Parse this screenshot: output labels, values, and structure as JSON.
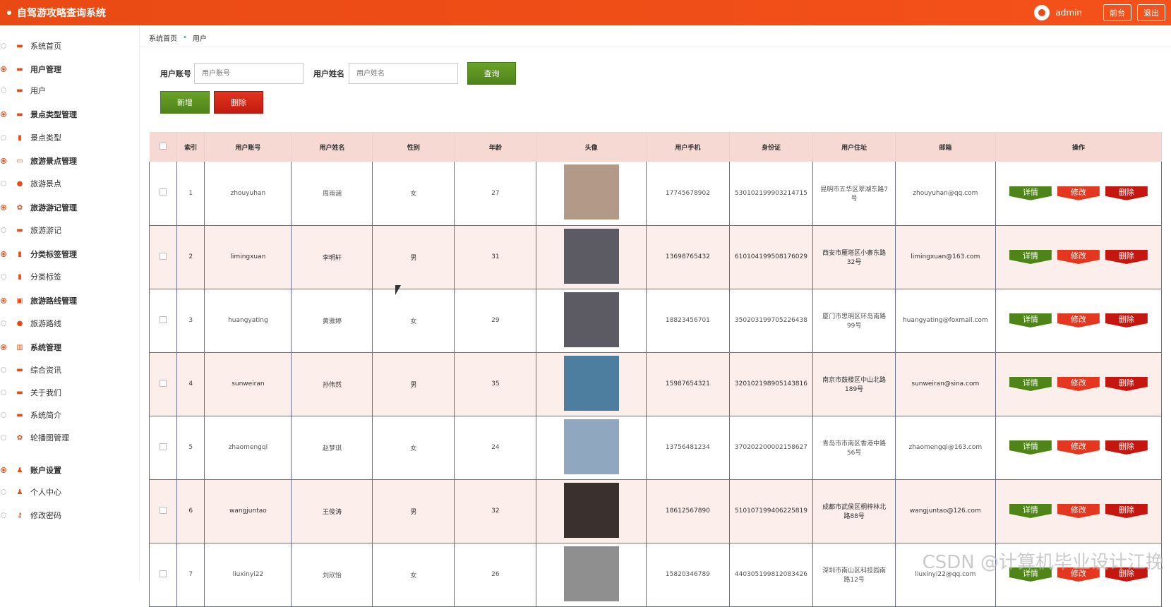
{
  "app": {
    "title": "自驾游攻略查询系统",
    "username": "admin",
    "front_btn": "前台",
    "logout_btn": "退出"
  },
  "sidebar": {
    "items": [
      {
        "label": "系统首页",
        "group": false,
        "icon": "briefcase-icon"
      },
      {
        "label": "用户管理",
        "group": true,
        "icon": "briefcase-icon"
      },
      {
        "label": "用户",
        "group": false,
        "icon": "briefcase-icon"
      },
      {
        "label": "景点类型管理",
        "group": true,
        "icon": "briefcase-icon"
      },
      {
        "label": "景点类型",
        "group": false,
        "icon": "bar-chart-icon"
      },
      {
        "label": "旅游景点管理",
        "group": true,
        "icon": "monitor-icon"
      },
      {
        "label": "旅游景点",
        "group": false,
        "icon": "location-pin-icon"
      },
      {
        "label": "旅游游记管理",
        "group": true,
        "icon": "gear-icon"
      },
      {
        "label": "旅游游记",
        "group": false,
        "icon": "briefcase-icon"
      },
      {
        "label": "分类标签管理",
        "group": true,
        "icon": "bar-chart-icon"
      },
      {
        "label": "分类标签",
        "group": false,
        "icon": "bar-chart-icon"
      },
      {
        "label": "旅游路线管理",
        "group": true,
        "icon": "image-icon"
      },
      {
        "label": "旅游路线",
        "group": false,
        "icon": "location-pin-icon"
      },
      {
        "label": "系统管理",
        "group": true,
        "icon": "building-icon"
      },
      {
        "label": "综合资讯",
        "group": false,
        "icon": "briefcase-icon"
      },
      {
        "label": "关于我们",
        "group": false,
        "icon": "briefcase-icon"
      },
      {
        "label": "系统简介",
        "group": false,
        "icon": "briefcase-icon"
      },
      {
        "label": "轮播图管理",
        "group": false,
        "icon": "gear-icon"
      },
      {
        "label": "账户设置",
        "group": true,
        "icon": "user-icon"
      },
      {
        "label": "个人中心",
        "group": false,
        "icon": "user-icon"
      },
      {
        "label": "修改密码",
        "group": false,
        "icon": "key-icon"
      }
    ]
  },
  "breadcrumb": {
    "home": "系统首页",
    "current": "用户"
  },
  "filter": {
    "account_label": "用户账号",
    "account_placeholder": "用户账号",
    "name_label": "用户姓名",
    "name_placeholder": "用户姓名",
    "query_btn": "查询",
    "add_btn": "新增",
    "delete_btn": "删除"
  },
  "table": {
    "headers": [
      "索引",
      "用户账号",
      "用户姓名",
      "性别",
      "年龄",
      "头像",
      "用户手机",
      "身份证",
      "用户住址",
      "邮箱",
      "操作"
    ],
    "rows": [
      {
        "idx": "1",
        "account": "zhouyuhan",
        "name": "周雨涵",
        "gender": "女",
        "age": "27",
        "phone": "17745678902",
        "idcard": "530102199903214715",
        "address": "昆明市五华区翠湖东路7号",
        "email": "zhouyuhan@qq.com",
        "photo_color": "#b39a88"
      },
      {
        "idx": "2",
        "account": "limingxuan",
        "name": "李明轩",
        "gender": "男",
        "age": "31",
        "phone": "13698765432",
        "idcard": "610104199508176029",
        "address": "西安市雁塔区小寨东路32号",
        "email": "limingxuan@163.com",
        "photo_color": "#5c5a63"
      },
      {
        "idx": "3",
        "account": "huangyating",
        "name": "黄雅婷",
        "gender": "女",
        "age": "29",
        "phone": "18823456701",
        "idcard": "350203199705226438",
        "address": "厦门市思明区环岛南路99号",
        "email": "huangyating@foxmail.com",
        "photo_color": "#5c5a63"
      },
      {
        "idx": "4",
        "account": "sunweiran",
        "name": "孙伟然",
        "gender": "男",
        "age": "35",
        "phone": "15987654321",
        "idcard": "320102198905143816",
        "address": "南京市鼓楼区中山北路189号",
        "email": "sunweiran@sina.com",
        "photo_color": "#4d7e9f"
      },
      {
        "idx": "5",
        "account": "zhaomengqi",
        "name": "赵梦琪",
        "gender": "女",
        "age": "24",
        "phone": "13756481234",
        "idcard": "370202200002158627",
        "address": "青岛市市南区香港中路56号",
        "email": "zhaomengqi@163.com",
        "photo_color": "#8fa8c0"
      },
      {
        "idx": "6",
        "account": "wangjuntao",
        "name": "王俊涛",
        "gender": "男",
        "age": "32",
        "phone": "18612567890",
        "idcard": "510107199406225819",
        "address": "成都市武侯区桐梓林北路88号",
        "email": "wangjuntao@126.com",
        "photo_color": "#3a302e"
      },
      {
        "idx": "7",
        "account": "liuxinyi22",
        "name": "刘欣怡",
        "gender": "女",
        "age": "26",
        "phone": "15820346789",
        "idcard": "440305199812083426",
        "address": "深圳市南山区科技园南路12号",
        "email": "liuxinyi22@qq.com",
        "photo_color": "#8f8f8f"
      }
    ],
    "actions": {
      "detail": "详情",
      "edit": "修改",
      "delete": "删除"
    }
  },
  "watermark": "CSDN @计算机毕业设计江挽"
}
